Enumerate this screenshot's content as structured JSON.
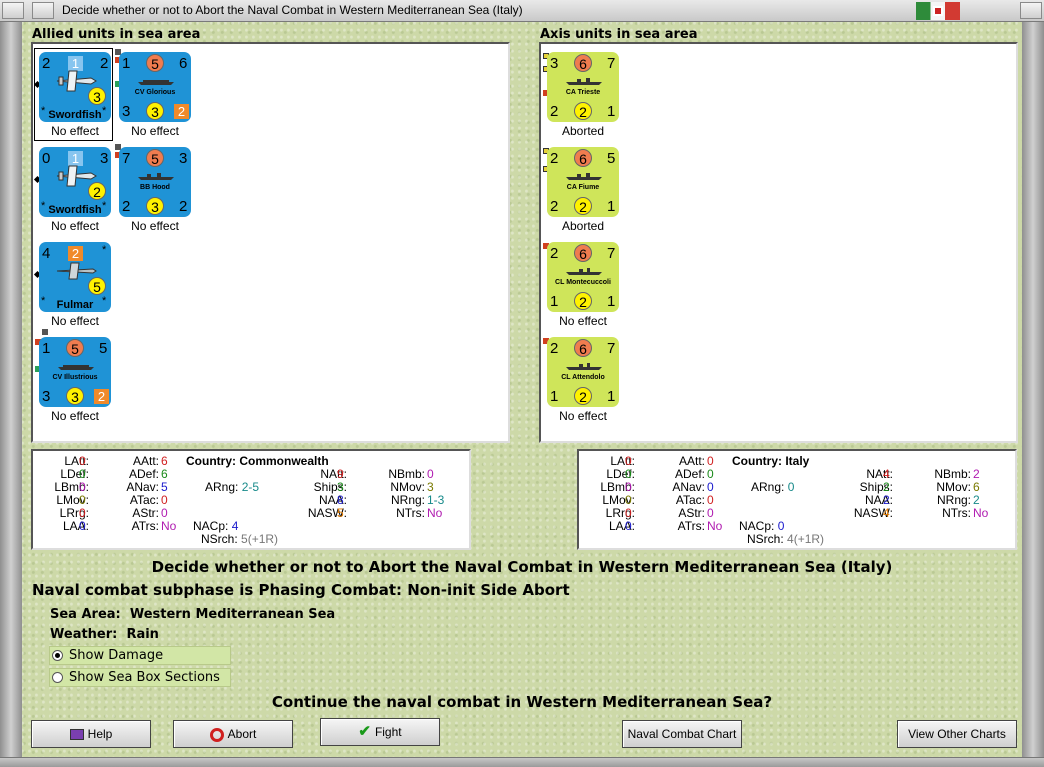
{
  "window": {
    "title": "Decide whether or not to Abort the Naval Combat in Western Mediterranean Sea (Italy)"
  },
  "allied": {
    "heading": "Allied units in sea area",
    "units": [
      {
        "name": "Swordfish",
        "tl": "2",
        "tr": "2",
        "top": "1",
        "circle": "3",
        "result": "No effect"
      },
      {
        "name": "CV Glorious",
        "tl": "1",
        "top": "5",
        "tr": "6",
        "bl": "3",
        "bm": "3",
        "br": "2",
        "result": "No effect"
      },
      {
        "name": "Swordfish",
        "tl": "0",
        "tr": "3",
        "top": "1",
        "circle": "2",
        "result": "No effect"
      },
      {
        "name": "BB Hood",
        "tl": "7",
        "top": "5",
        "tr": "3",
        "bl": "2",
        "bm": "3",
        "br": "2",
        "result": "No effect"
      },
      {
        "name": "Fulmar",
        "tl": "4",
        "top": "2",
        "circle": "5",
        "result": "No effect"
      },
      {
        "name": "CV Illustrious",
        "tl": "1",
        "top": "5",
        "tr": "5",
        "bl": "3",
        "bm": "3",
        "br": "2",
        "result": "No effect"
      }
    ]
  },
  "axis": {
    "heading": "Axis units in sea area",
    "units": [
      {
        "name": "CA Trieste",
        "tl": "3",
        "top": "6",
        "tr": "7",
        "bl": "2",
        "bm": "2",
        "br": "1",
        "result": "Aborted"
      },
      {
        "name": "CA Fiume",
        "tl": "2",
        "top": "6",
        "tr": "5",
        "bl": "2",
        "bm": "2",
        "br": "1",
        "result": "Aborted"
      },
      {
        "name": "CL Montecuccoli",
        "tl": "2",
        "top": "6",
        "tr": "7",
        "bl": "1",
        "bm": "2",
        "br": "1",
        "result": "No effect"
      },
      {
        "name": "CL Attendolo",
        "tl": "2",
        "top": "6",
        "tr": "7",
        "bl": "1",
        "bm": "2",
        "br": "1",
        "result": "No effect"
      }
    ]
  },
  "allied_stats": {
    "latt": "0",
    "ldef": "0",
    "lbmb": "0",
    "lmov": "0",
    "lrrg": "0",
    "laa": "0",
    "aatt": "6",
    "adef": "6",
    "anav": "5",
    "atac": "0",
    "astr": "0",
    "atrs": "No",
    "country": "Commonwealth",
    "arng": "2-5",
    "natt": "9",
    "ships": "3",
    "naa": "8",
    "nasw": "5",
    "nacp": "4",
    "nsrch": "5(+1R)",
    "nbmb": "0",
    "nmov": "3",
    "nrng": "1-3",
    "ntrs": "No"
  },
  "axis_stats": {
    "latt": "0",
    "ldef": "0",
    "lbmb": "0",
    "lmov": "0",
    "lrrg": "0",
    "laa": "0",
    "aatt": "0",
    "adef": "0",
    "anav": "0",
    "atac": "0",
    "astr": "0",
    "atrs": "No",
    "country": "Italy",
    "arng": "0",
    "natt": "4",
    "ships": "2",
    "naa": "2",
    "nasw": "4",
    "nacp": "0",
    "nsrch": "4(+1R)",
    "nbmb": "2",
    "nmov": "6",
    "nrng": "2",
    "ntrs": "No"
  },
  "labels": {
    "latt": "LAtt:",
    "ldef": "LDef:",
    "lbmb": "LBmb:",
    "lmov": "LMov:",
    "lrrg": "LRrg:",
    "laa": "LAA:",
    "aatt": "AAtt:",
    "adef": "ADef:",
    "anav": "ANav:",
    "atac": "ATac:",
    "astr": "AStr:",
    "atrs": "ATrs:",
    "country": "Country:",
    "arng": "ARng:",
    "natt": "NAtt:",
    "ships": "Ships:",
    "naa": "NAA:",
    "nasw": "NASW:",
    "nacp": "NACp:",
    "nsrch": "NSrch:",
    "nbmb": "NBmb:",
    "nmov": "NMov:",
    "nrng": "NRng:",
    "ntrs": "NTrs:"
  },
  "main": {
    "heading": "Decide whether or not to Abort the Naval Combat in Western Mediterranean Sea (Italy)",
    "subphase": "Naval combat subphase is Phasing Combat: Non-init Side Abort",
    "sea_area_label": "Sea Area:",
    "sea_area": "Western Mediterranean Sea",
    "weather_label": "Weather:",
    "weather": "Rain",
    "show_damage": "Show Damage",
    "show_sea_box": "Show Sea Box Sections",
    "question": "Continue the naval combat in Western Mediterranean Sea?"
  },
  "buttons": {
    "help": "Help",
    "abort": "Abort",
    "fight": "Fight",
    "chart": "Naval Combat Chart",
    "other": "View Other Charts"
  },
  "colors": {
    "allied_unit": "#1f93d6",
    "axis_unit": "#cfe55a",
    "background": "#cdd9a8"
  }
}
